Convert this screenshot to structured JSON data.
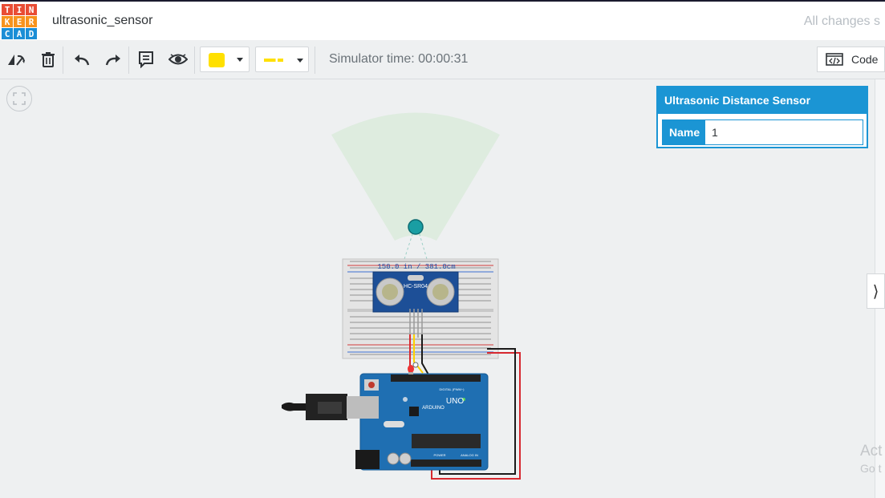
{
  "app": {
    "logo_letters": [
      "T",
      "I",
      "N",
      "K",
      "E",
      "R",
      "C",
      "A",
      "D"
    ],
    "logo_colors": [
      "#e94d35",
      "#e94d35",
      "#e94d35",
      "#f7931e",
      "#f7931e",
      "#f7931e",
      "#1b8ed6",
      "#1b8ed6",
      "#1b8ed6"
    ],
    "project_title": "ultrasonic_sensor",
    "save_status": "All changes s"
  },
  "toolbar": {
    "icons": [
      "rotate-icon",
      "delete-icon",
      "undo-icon",
      "redo-icon",
      "notes-icon",
      "eye-icon"
    ],
    "color_swatch": "#ffe000",
    "wire_color": "#ffe000",
    "simulator_time_label": "Simulator time: 00:00:31",
    "code_label": "Code"
  },
  "circuit": {
    "sensor_label": "HC-SR04",
    "distance_readout": "150.0 in / 381.0cm",
    "board_brand": "ARDUINO",
    "board_model": "UNO",
    "header_labels": [
      "DIGITAL (PWM~)",
      "POWER",
      "ANALOG IN"
    ]
  },
  "inspector": {
    "title": "Ultrasonic Distance Sensor",
    "name_label": "Name",
    "name_value": "1"
  },
  "watermark": {
    "line1": "Act",
    "line2": "Go t"
  },
  "colors": {
    "accent": "#1b95d4",
    "board": "#1f6fb2",
    "wire_red": "#d7282f",
    "wire_black": "#1a1a1a",
    "wire_yellow": "#ffd200",
    "sensor_beam": "#dcebdd"
  }
}
